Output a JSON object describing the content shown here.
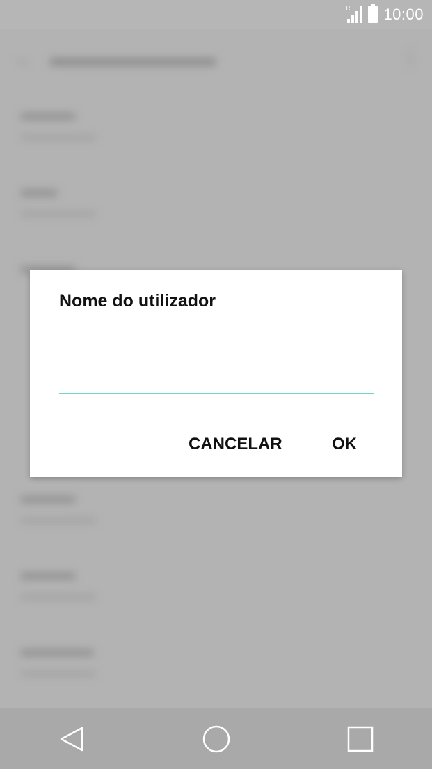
{
  "status_bar": {
    "time": "10:00",
    "icons": [
      "roaming-signal-icon",
      "battery-icon"
    ]
  },
  "dialog": {
    "title": "Nome do utilizador",
    "input_value": "",
    "cancel_label": "CANCELAR",
    "ok_label": "OK",
    "accent_color": "#6fd6c8"
  },
  "navigation": {
    "icons": [
      "back-icon",
      "home-icon",
      "recents-icon"
    ]
  }
}
